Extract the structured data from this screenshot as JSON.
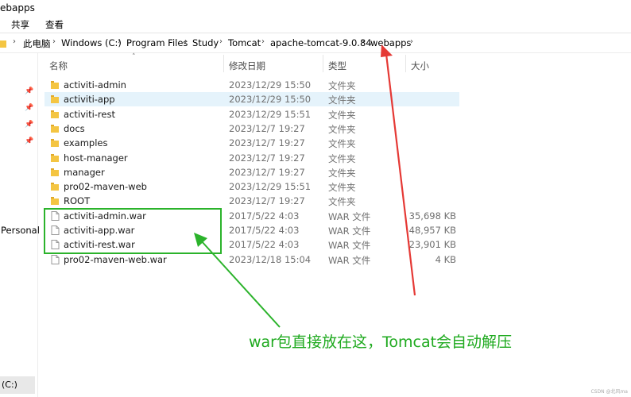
{
  "window": {
    "title": "ebapps"
  },
  "ribbon": {
    "tabs": [
      "共享",
      "查看"
    ]
  },
  "address_bar": {
    "crumbs": [
      "此电脑",
      "Windows (C:)",
      "Program Files",
      "Study",
      "Tomcat",
      "apache-tomcat-9.0.84",
      "webapps"
    ]
  },
  "nav_pane": {
    "personal_label": "Personal",
    "drive_label": "(C:)"
  },
  "columns": {
    "name": "名称",
    "date": "修改日期",
    "type": "类型",
    "size": "大小"
  },
  "files": [
    {
      "name": "activiti-admin",
      "date": "2023/12/29 15:50",
      "type": "文件夹",
      "size": "",
      "kind": "folder"
    },
    {
      "name": "activiti-app",
      "date": "2023/12/29 15:50",
      "type": "文件夹",
      "size": "",
      "kind": "folder",
      "selected": true
    },
    {
      "name": "activiti-rest",
      "date": "2023/12/29 15:51",
      "type": "文件夹",
      "size": "",
      "kind": "folder"
    },
    {
      "name": "docs",
      "date": "2023/12/7 19:27",
      "type": "文件夹",
      "size": "",
      "kind": "folder"
    },
    {
      "name": "examples",
      "date": "2023/12/7 19:27",
      "type": "文件夹",
      "size": "",
      "kind": "folder"
    },
    {
      "name": "host-manager",
      "date": "2023/12/7 19:27",
      "type": "文件夹",
      "size": "",
      "kind": "folder"
    },
    {
      "name": "manager",
      "date": "2023/12/7 19:27",
      "type": "文件夹",
      "size": "",
      "kind": "folder"
    },
    {
      "name": "pro02-maven-web",
      "date": "2023/12/29 15:51",
      "type": "文件夹",
      "size": "",
      "kind": "folder"
    },
    {
      "name": "ROOT",
      "date": "2023/12/7 19:27",
      "type": "文件夹",
      "size": "",
      "kind": "folder"
    },
    {
      "name": "activiti-admin.war",
      "date": "2017/5/22 4:03",
      "type": "WAR 文件",
      "size": "35,698 KB",
      "kind": "file"
    },
    {
      "name": "activiti-app.war",
      "date": "2017/5/22 4:03",
      "type": "WAR 文件",
      "size": "48,957 KB",
      "kind": "file"
    },
    {
      "name": "activiti-rest.war",
      "date": "2017/5/22 4:03",
      "type": "WAR 文件",
      "size": "23,901 KB",
      "kind": "file"
    },
    {
      "name": "pro02-maven-web.war",
      "date": "2023/12/18 15:04",
      "type": "WAR 文件",
      "size": "4 KB",
      "kind": "file"
    }
  ],
  "annotation": {
    "text": "war包直接放在这，Tomcat会自动解压"
  },
  "watermark": "CSDN @北风ma",
  "colors": {
    "arrow_red": "#e53935",
    "annotation_green": "#2bb32b",
    "selection": "#e5f3fb",
    "folder": "#f4c542"
  }
}
